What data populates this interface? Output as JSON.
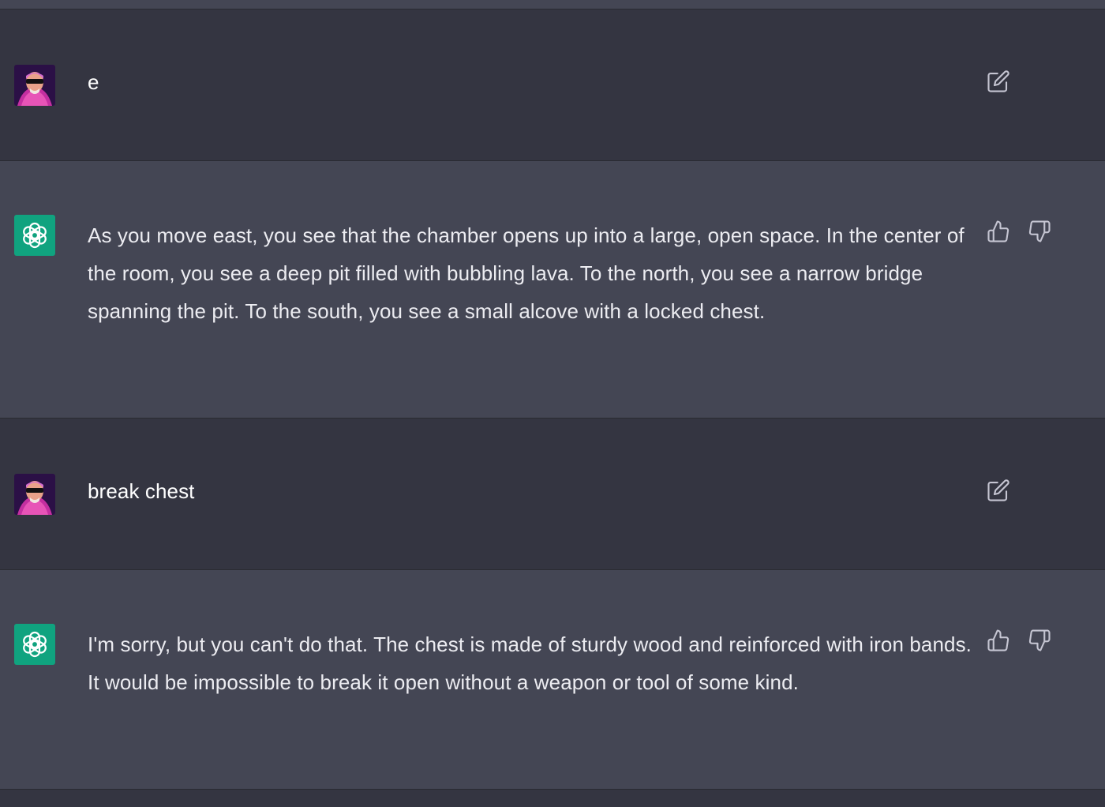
{
  "conversation": [
    {
      "role": "user",
      "text": "e",
      "action_icons": [
        "edit-icon"
      ]
    },
    {
      "role": "assistant",
      "text": "As you move east, you see that the chamber opens up into a large, open space. In the center of the room, you see a deep pit filled with bubbling lava. To the north, you see a narrow bridge spanning the pit. To the south, you see a small alcove with a locked chest.",
      "action_icons": [
        "thumbs-up-icon",
        "thumbs-down-icon"
      ]
    },
    {
      "role": "user",
      "text": "break chest",
      "action_icons": [
        "edit-icon"
      ]
    },
    {
      "role": "assistant",
      "text": "I'm sorry, but you can't do that. The chest is made of sturdy wood and reinforced with iron bands. It would be impossible to break it open without a weapon or tool of some kind.",
      "action_icons": [
        "thumbs-up-icon",
        "thumbs-down-icon"
      ]
    }
  ],
  "colors": {
    "user_row_bg": "#343541",
    "assistant_row_bg": "#444654",
    "assistant_avatar_bg": "#10a37f",
    "text": "#ececf1",
    "icon": "#c5c5d2"
  }
}
